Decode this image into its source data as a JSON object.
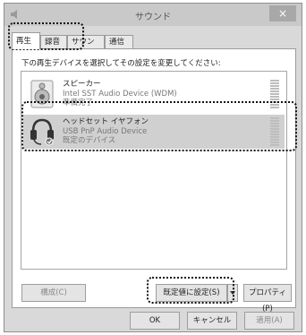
{
  "window": {
    "title": "サウンド",
    "close_label": "×"
  },
  "tabs": [
    {
      "label": "再生",
      "active": true
    },
    {
      "label": "録音",
      "active": false
    },
    {
      "label": "サウンド",
      "active": false
    },
    {
      "label": "通信",
      "active": false
    }
  ],
  "panel": {
    "instruction": "下の再生デバイスを選択してその設定を変更してください:"
  },
  "devices": [
    {
      "name": "スピーカー",
      "driver": "Intel SST Audio Device (WDM)",
      "status": "準備完了",
      "icon": "speaker-icon",
      "selected": false
    },
    {
      "name": "ヘッドセット イヤフォン",
      "driver": "USB PnP Audio Device",
      "status": "既定のデバイス",
      "icon": "headset-icon",
      "selected": true
    }
  ],
  "buttons": {
    "configure": "構成(C)",
    "set_default": "既定値に設定(S)",
    "properties": "プロパティ(P)",
    "ok": "OK",
    "cancel": "キャンセル",
    "apply": "適用(A)"
  },
  "colors": {
    "highlight_outline": "#111111",
    "selected_row": "#d0d0d0"
  }
}
